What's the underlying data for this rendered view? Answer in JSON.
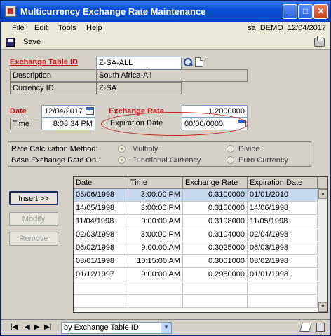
{
  "window": {
    "title": "Multicurrency Exchange Rate Maintenance",
    "min": "_",
    "max": "□",
    "close": "✕"
  },
  "menu": {
    "file": "File",
    "edit": "Edit",
    "tools": "Tools",
    "help": "Help",
    "user": "sa",
    "company": "DEMO",
    "date": "12/04/2017"
  },
  "toolbar": {
    "save_label": "Save"
  },
  "form": {
    "exchange_table_id_label": "Exchange Table ID",
    "exchange_table_id": "Z-SA-ALL",
    "description_label": "Description",
    "description": "South Africa-All",
    "currency_id_label": "Currency ID",
    "currency_id": "Z-SA",
    "date_label": "Date",
    "date": "12/04/2017",
    "time_label": "Time",
    "time": "8:08:34 PM",
    "exchange_rate_label": "Exchange Rate",
    "exchange_rate": "1.2000000",
    "expiration_date_label": "Expiration Date",
    "expiration_date": "00/00/0000"
  },
  "options": {
    "rate_calc_label": "Rate Calculation Method:",
    "rate_calc_1": "Multiply",
    "rate_calc_2": "Divide",
    "base_rate_label": "Base Exchange Rate On:",
    "base_rate_1": "Functional Currency",
    "base_rate_2": "Euro Currency"
  },
  "buttons": {
    "insert": "Insert >>",
    "modify": "Modify",
    "remove": "Remove"
  },
  "table": {
    "headers": [
      "Date",
      "Time",
      "Exchange Rate",
      "Expiration Date"
    ],
    "rows": [
      [
        "05/06/1998",
        "3:00:00 PM",
        "0.3100000",
        "01/01/2010"
      ],
      [
        "14/05/1998",
        "3:00:00 PM",
        "0.3150000",
        "14/06/1998"
      ],
      [
        "11/04/1998",
        "9:00:00 AM",
        "0.3198000",
        "11/05/1998"
      ],
      [
        "02/03/1998",
        "3:00:00 PM",
        "0.3104000",
        "02/04/1998"
      ],
      [
        "06/02/1998",
        "9:00:00 AM",
        "0.3025000",
        "06/03/1998"
      ],
      [
        "03/01/1998",
        "10:15:00 AM",
        "0.3001000",
        "03/02/1998"
      ],
      [
        "01/12/1997",
        "9:00:00 AM",
        "0.2980000",
        "01/01/1998"
      ]
    ]
  },
  "status": {
    "first": "|◀",
    "prev": "◀",
    "next": "▶",
    "last": "▶|",
    "sort_by": "by Exchange Table ID",
    "dropdown": "▼"
  },
  "scroll": {
    "up": "▲",
    "down": "▼"
  }
}
